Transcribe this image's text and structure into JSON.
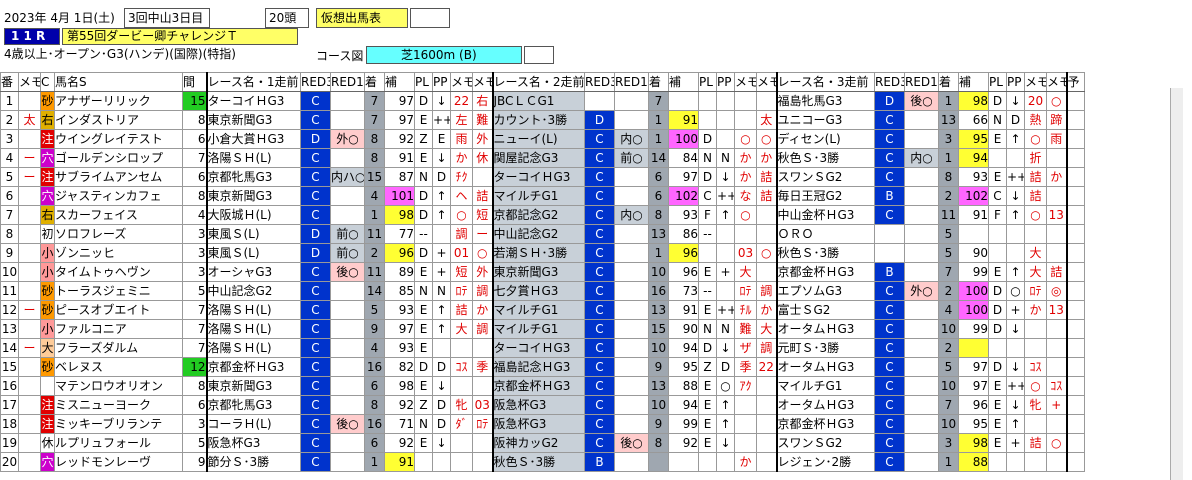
{
  "header": {
    "date": "2023年 4月 1日(土)",
    "meeting": "3回中山3日目",
    "runners": "20頭",
    "mode": "仮想出馬表",
    "race_no": "1 1 R",
    "race_name": "第55回ダービー卿チャレンジＴ",
    "conditions": "4歳以上･オープン･G3(ハンデ)(国際)(特指)",
    "course_label": "コース図",
    "course": "芝1600m (B)"
  },
  "columns": [
    "番",
    "メモ",
    "C",
    "馬名S",
    "間",
    "レース名・1走前",
    "RED3",
    "RED1",
    "着",
    "補",
    "PL",
    "PP",
    "メモ",
    "メモ",
    "レース名・2走前",
    "RED3",
    "RED1",
    "着",
    "補",
    "PL",
    "PP",
    "メモ",
    "メモ",
    "レース名・3走前",
    "RED3",
    "RED1",
    "着",
    "補",
    "PL",
    "PP",
    "メモ",
    "メモ",
    "予"
  ],
  "rows": [
    {
      "no": "1",
      "memo": "",
      "mark": "砂",
      "name": "アナザーリリック",
      "gap": "15",
      "r1": {
        "race": "ターコイＨG3",
        "a": "C",
        "b": "",
        "pos": "7",
        "hosei": "97",
        "pl": "D",
        "pp": "↓",
        "m1": "22",
        "m2": "右"
      },
      "r2": {
        "race": "JBCＬＣG1",
        "a": "",
        "b": "",
        "pos": "7",
        "hosei": "",
        "pl": "",
        "pp": "",
        "m1": "",
        "m2": ""
      },
      "r3": {
        "race": "福島牝馬G3",
        "a": "D",
        "b": "後○",
        "pos": "1",
        "hosei": "98",
        "pl": "D",
        "pp": "↓",
        "m1": "20",
        "m2": "○"
      }
    },
    {
      "no": "2",
      "memo": "太",
      "mark": "右",
      "name": "インダストリア",
      "gap": "8",
      "r1": {
        "race": "東京新聞G3",
        "a": "C",
        "b": "",
        "pos": "7",
        "hosei": "97",
        "pl": "E",
        "pp": "++",
        "m1": "左",
        "m2": "難"
      },
      "r2": {
        "race": "カウント･3勝",
        "a": "D",
        "b": "",
        "pos": "1",
        "hosei": "91",
        "pl": "",
        "pp": "",
        "m1": "",
        "m2": "太"
      },
      "r3": {
        "race": "ユニコーG3",
        "a": "C",
        "b": "",
        "pos": "13",
        "hosei": "66",
        "pl": "N",
        "pp": "D",
        "m1": "熱",
        "m2": "蹄"
      }
    },
    {
      "no": "3",
      "memo": "",
      "mark": "注",
      "name": "ウイングレイテスト",
      "gap": "6",
      "r1": {
        "race": "小倉大賞ＨG3",
        "a": "D",
        "b": "外○",
        "pos": "8",
        "hosei": "92",
        "pl": "Z",
        "pp": "E",
        "m1": "雨",
        "m2": "外"
      },
      "r2": {
        "race": "ニューイ(L)",
        "a": "C",
        "b": "内○",
        "pos": "1",
        "hosei": "100",
        "pl": "D",
        "pp": "",
        "m1": "○",
        "m2": "○"
      },
      "r3": {
        "race": "ディセン(L)",
        "a": "C",
        "b": "",
        "pos": "3",
        "hosei": "95",
        "pl": "E",
        "pp": "↑",
        "m1": "○",
        "m2": "雨"
      }
    },
    {
      "no": "4",
      "memo": "ー",
      "mark": "穴",
      "name": "ゴールデンシロップ",
      "gap": "7",
      "r1": {
        "race": "洛陽ＳＨ(L)",
        "a": "C",
        "b": "",
        "pos": "8",
        "hosei": "91",
        "pl": "E",
        "pp": "↓",
        "m1": "か",
        "m2": "休"
      },
      "r2": {
        "race": "関屋記念G3",
        "a": "C",
        "b": "前○",
        "pos": "14",
        "hosei": "84",
        "pl": "N",
        "pp": "N",
        "m1": "か",
        "m2": "か"
      },
      "r3": {
        "race": "秋色Ｓ･3勝",
        "a": "C",
        "b": "内○",
        "pos": "1",
        "hosei": "94",
        "pl": "",
        "pp": "",
        "m1": "折",
        "m2": ""
      }
    },
    {
      "no": "5",
      "memo": "ー",
      "mark": "注",
      "name": "サブライムアンセム",
      "gap": "6",
      "r1": {
        "race": "京都牝馬G3",
        "a": "C",
        "b": "内ハ○",
        "pos": "15",
        "hosei": "87",
        "pl": "N",
        "pp": "D",
        "m1": "ﾁｸ",
        "m2": ""
      },
      "r2": {
        "race": "ターコイＨG3",
        "a": "C",
        "b": "",
        "pos": "6",
        "hosei": "97",
        "pl": "D",
        "pp": "↓",
        "m1": "か",
        "m2": "詰"
      },
      "r3": {
        "race": "スワンＳG2",
        "a": "C",
        "b": "",
        "pos": "8",
        "hosei": "93",
        "pl": "E",
        "pp": "++",
        "m1": "詰",
        "m2": "か"
      }
    },
    {
      "no": "6",
      "memo": "",
      "mark": "穴",
      "name": "ジャスティンカフェ",
      "gap": "8",
      "r1": {
        "race": "東京新聞G3",
        "a": "C",
        "b": "",
        "pos": "4",
        "hosei": "101",
        "pl": "D",
        "pp": "↑",
        "m1": "ヘ",
        "m2": "詰"
      },
      "r2": {
        "race": "マイルチG1",
        "a": "C",
        "b": "",
        "pos": "6",
        "hosei": "102",
        "pl": "C",
        "pp": "++",
        "m1": "な",
        "m2": "詰"
      },
      "r3": {
        "race": "毎日王冠G2",
        "a": "B",
        "b": "",
        "pos": "2",
        "hosei": "102",
        "pl": "C",
        "pp": "↓",
        "m1": "詰",
        "m2": ""
      }
    },
    {
      "no": "7",
      "memo": "",
      "mark": "右",
      "name": "スカーフェイス",
      "gap": "4",
      "r1": {
        "race": "大阪城Ｈ(L)",
        "a": "C",
        "b": "",
        "pos": "1",
        "hosei": "98",
        "pl": "D",
        "pp": "↑",
        "m1": "○",
        "m2": "短"
      },
      "r2": {
        "race": "京都記念G2",
        "a": "C",
        "b": "内○",
        "pos": "8",
        "hosei": "93",
        "pl": "F",
        "pp": "↑",
        "m1": "○",
        "m2": ""
      },
      "r3": {
        "race": "中山金杯ＨG3",
        "a": "C",
        "b": "",
        "pos": "11",
        "hosei": "91",
        "pl": "F",
        "pp": "↑",
        "m1": "○",
        "m2": "13"
      }
    },
    {
      "no": "8",
      "memo": "",
      "mark": "初",
      "name": "ソロフレーズ",
      "gap": "3",
      "r1": {
        "race": "東風Ｓ(L)",
        "a": "D",
        "b": "前○",
        "pos": "11",
        "hosei": "77",
        "pl": "--",
        "pp": "",
        "m1": "調",
        "m2": "ー"
      },
      "r2": {
        "race": "中山記念G2",
        "a": "C",
        "b": "",
        "pos": "13",
        "hosei": "86",
        "pl": "--",
        "pp": "",
        "m1": "",
        "m2": ""
      },
      "r3": {
        "race": "ＯＲＯ",
        "a": "",
        "b": "",
        "pos": "5",
        "hosei": "",
        "pl": "",
        "pp": "",
        "m1": "",
        "m2": ""
      }
    },
    {
      "no": "9",
      "memo": "",
      "mark": "小",
      "name": "ゾンニッヒ",
      "gap": "3",
      "r1": {
        "race": "東風Ｓ(L)",
        "a": "D",
        "b": "前○",
        "pos": "2",
        "hosei": "96",
        "pl": "D",
        "pp": "+",
        "m1": "01",
        "m2": "○"
      },
      "r2": {
        "race": "若潮ＳＨ･3勝",
        "a": "C",
        "b": "",
        "pos": "1",
        "hosei": "96",
        "pl": "",
        "pp": "",
        "m1": "03",
        "m2": "○"
      },
      "r3": {
        "race": "秋色Ｓ･3勝",
        "a": "",
        "b": "",
        "pos": "5",
        "hosei": "90",
        "pl": "",
        "pp": "",
        "m1": "大",
        "m2": ""
      }
    },
    {
      "no": "10",
      "memo": "",
      "mark": "小",
      "name": "タイムトゥヘヴン",
      "gap": "3",
      "r1": {
        "race": "オーシャG3",
        "a": "C",
        "b": "後○",
        "pos": "11",
        "hosei": "89",
        "pl": "E",
        "pp": "+",
        "m1": "短",
        "m2": "外"
      },
      "r2": {
        "race": "東京新聞G3",
        "a": "C",
        "b": "",
        "pos": "10",
        "hosei": "96",
        "pl": "E",
        "pp": "+",
        "m1": "大",
        "m2": ""
      },
      "r3": {
        "race": "京都金杯ＨG3",
        "a": "B",
        "b": "",
        "pos": "7",
        "hosei": "99",
        "pl": "E",
        "pp": "↑",
        "m1": "大",
        "m2": "詰"
      }
    },
    {
      "no": "11",
      "memo": "",
      "mark": "砂",
      "name": "トーラスジェミニ",
      "gap": "5",
      "r1": {
        "race": "中山記念G2",
        "a": "C",
        "b": "",
        "pos": "14",
        "hosei": "85",
        "pl": "N",
        "pp": "N",
        "m1": "ﾛﾃ",
        "m2": "調"
      },
      "r2": {
        "race": "七夕賞ＨG3",
        "a": "C",
        "b": "",
        "pos": "16",
        "hosei": "73",
        "pl": "--",
        "pp": "",
        "m1": "ﾛﾃ",
        "m2": "調"
      },
      "r3": {
        "race": "エプソムG3",
        "a": "C",
        "b": "外○",
        "pos": "2",
        "hosei": "100",
        "pl": "D",
        "pp": "○",
        "m1": "ﾛﾃ",
        "m2": "◎"
      }
    },
    {
      "no": "12",
      "memo": "ー",
      "mark": "砂",
      "name": "ピースオブエイト",
      "gap": "7",
      "r1": {
        "race": "洛陽ＳＨ(L)",
        "a": "C",
        "b": "",
        "pos": "5",
        "hosei": "93",
        "pl": "E",
        "pp": "↑",
        "m1": "詰",
        "m2": "か"
      },
      "r2": {
        "race": "マイルチG1",
        "a": "C",
        "b": "",
        "pos": "13",
        "hosei": "91",
        "pl": "E",
        "pp": "++",
        "m1": "ﾁﾙ",
        "m2": "か"
      },
      "r3": {
        "race": "富士ＳG2",
        "a": "C",
        "b": "",
        "pos": "4",
        "hosei": "100",
        "pl": "D",
        "pp": "+",
        "m1": "か",
        "m2": "13"
      }
    },
    {
      "no": "13",
      "memo": "",
      "mark": "小",
      "name": "ファルコニア",
      "gap": "7",
      "r1": {
        "race": "洛陽ＳＨ(L)",
        "a": "C",
        "b": "",
        "pos": "9",
        "hosei": "97",
        "pl": "E",
        "pp": "↑",
        "m1": "大",
        "m2": "調"
      },
      "r2": {
        "race": "マイルチG1",
        "a": "C",
        "b": "",
        "pos": "15",
        "hosei": "90",
        "pl": "N",
        "pp": "N",
        "m1": "難",
        "m2": "大"
      },
      "r3": {
        "race": "オータムＨG3",
        "a": "C",
        "b": "",
        "pos": "10",
        "hosei": "99",
        "pl": "D",
        "pp": "↓",
        "m1": "",
        "m2": ""
      }
    },
    {
      "no": "14",
      "memo": "ー",
      "mark": "大",
      "name": "フラーズダルム",
      "gap": "7",
      "r1": {
        "race": "洛陽ＳＨ(L)",
        "a": "C",
        "b": "",
        "pos": "4",
        "hosei": "93",
        "pl": "E",
        "pp": "",
        "m1": "",
        "m2": ""
      },
      "r2": {
        "race": "ターコイＨG3",
        "a": "C",
        "b": "",
        "pos": "10",
        "hosei": "94",
        "pl": "D",
        "pp": "↓",
        "m1": "ザ",
        "m2": "調"
      },
      "r3": {
        "race": "元町Ｓ･3勝",
        "a": "C",
        "b": "",
        "pos": "2",
        "hosei": "",
        "pl": "",
        "pp": "",
        "m1": "",
        "m2": ""
      }
    },
    {
      "no": "15",
      "memo": "",
      "mark": "砂",
      "name": "ベレヌス",
      "gap": "12",
      "r1": {
        "race": "京都金杯ＨG3",
        "a": "C",
        "b": "",
        "pos": "16",
        "hosei": "82",
        "pl": "D",
        "pp": "D",
        "m1": "ｺｽ",
        "m2": "季"
      },
      "r2": {
        "race": "福島記念ＨG3",
        "a": "C",
        "b": "",
        "pos": "9",
        "hosei": "95",
        "pl": "Z",
        "pp": "D",
        "m1": "季",
        "m2": "22"
      },
      "r3": {
        "race": "オータムＨG3",
        "a": "C",
        "b": "",
        "pos": "5",
        "hosei": "97",
        "pl": "D",
        "pp": "↓",
        "m1": "ｺｽ",
        "m2": ""
      }
    },
    {
      "no": "16",
      "memo": "",
      "mark": "",
      "name": "マテンロウオリオン",
      "gap": "8",
      "r1": {
        "race": "東京新聞G3",
        "a": "C",
        "b": "",
        "pos": "6",
        "hosei": "98",
        "pl": "E",
        "pp": "↓",
        "m1": "",
        "m2": ""
      },
      "r2": {
        "race": "京都金杯ＨG3",
        "a": "C",
        "b": "",
        "pos": "13",
        "hosei": "88",
        "pl": "E",
        "pp": "○",
        "m1": "ｱｸ",
        "m2": ""
      },
      "r3": {
        "race": "マイルチG1",
        "a": "C",
        "b": "",
        "pos": "10",
        "hosei": "97",
        "pl": "E",
        "pp": "++",
        "m1": "○",
        "m2": "ｺｽ"
      }
    },
    {
      "no": "17",
      "memo": "",
      "mark": "注",
      "name": "ミスニューヨーク",
      "gap": "6",
      "r1": {
        "race": "京都牝馬G3",
        "a": "C",
        "b": "",
        "pos": "8",
        "hosei": "92",
        "pl": "Z",
        "pp": "D",
        "m1": "牝",
        "m2": "03"
      },
      "r2": {
        "race": "阪急杯G3",
        "a": "C",
        "b": "",
        "pos": "10",
        "hosei": "94",
        "pl": "E",
        "pp": "↑",
        "m1": "",
        "m2": ""
      },
      "r3": {
        "race": "オータムＨG3",
        "a": "C",
        "b": "",
        "pos": "7",
        "hosei": "96",
        "pl": "E",
        "pp": "↓",
        "m1": "牝",
        "m2": "+"
      }
    },
    {
      "no": "18",
      "memo": "",
      "mark": "注",
      "name": "ミッキーブリランテ",
      "gap": "3",
      "r1": {
        "race": "コーラＨ(L)",
        "a": "C",
        "b": "後○",
        "pos": "16",
        "hosei": "71",
        "pl": "N",
        "pp": "D",
        "m1": "ﾀﾞ",
        "m2": "ﾛﾃ"
      },
      "r2": {
        "race": "阪急杯G3",
        "a": "C",
        "b": "",
        "pos": "9",
        "hosei": "99",
        "pl": "E",
        "pp": "↑",
        "m1": "",
        "m2": ""
      },
      "r3": {
        "race": "京都金杯ＨG3",
        "a": "C",
        "b": "",
        "pos": "10",
        "hosei": "95",
        "pl": "E",
        "pp": "↑",
        "m1": "",
        "m2": ""
      }
    },
    {
      "no": "19",
      "memo": "",
      "mark": "休",
      "name": "ルプリュフォール",
      "gap": "5",
      "r1": {
        "race": "阪急杯G3",
        "a": "C",
        "b": "",
        "pos": "6",
        "hosei": "92",
        "pl": "E",
        "pp": "↓",
        "m1": "",
        "m2": ""
      },
      "r2": {
        "race": "阪神カッG2",
        "a": "C",
        "b": "後○",
        "pos": "8",
        "hosei": "92",
        "pl": "E",
        "pp": "↓",
        "m1": "",
        "m2": ""
      },
      "r3": {
        "race": "スワンＳG2",
        "a": "C",
        "b": "",
        "pos": "3",
        "hosei": "98",
        "pl": "E",
        "pp": "+",
        "m1": "詰",
        "m2": "○"
      }
    },
    {
      "no": "20",
      "memo": "",
      "mark": "穴",
      "name": "レッドモンレーヴ",
      "gap": "9",
      "r1": {
        "race": "節分Ｓ･3勝",
        "a": "C",
        "b": "",
        "pos": "1",
        "hosei": "91",
        "pl": "",
        "pp": "",
        "m1": "",
        "m2": ""
      },
      "r2": {
        "race": "秋色Ｓ･3勝",
        "a": "B",
        "b": "",
        "pos": "",
        "hosei": "",
        "pl": "",
        "pp": "",
        "m1": "か",
        "m2": ""
      },
      "r3": {
        "race": "レジェン･2勝",
        "a": "C",
        "b": "",
        "pos": "1",
        "hosei": "88",
        "pl": "",
        "pp": "",
        "m1": "",
        "m2": ""
      }
    }
  ]
}
